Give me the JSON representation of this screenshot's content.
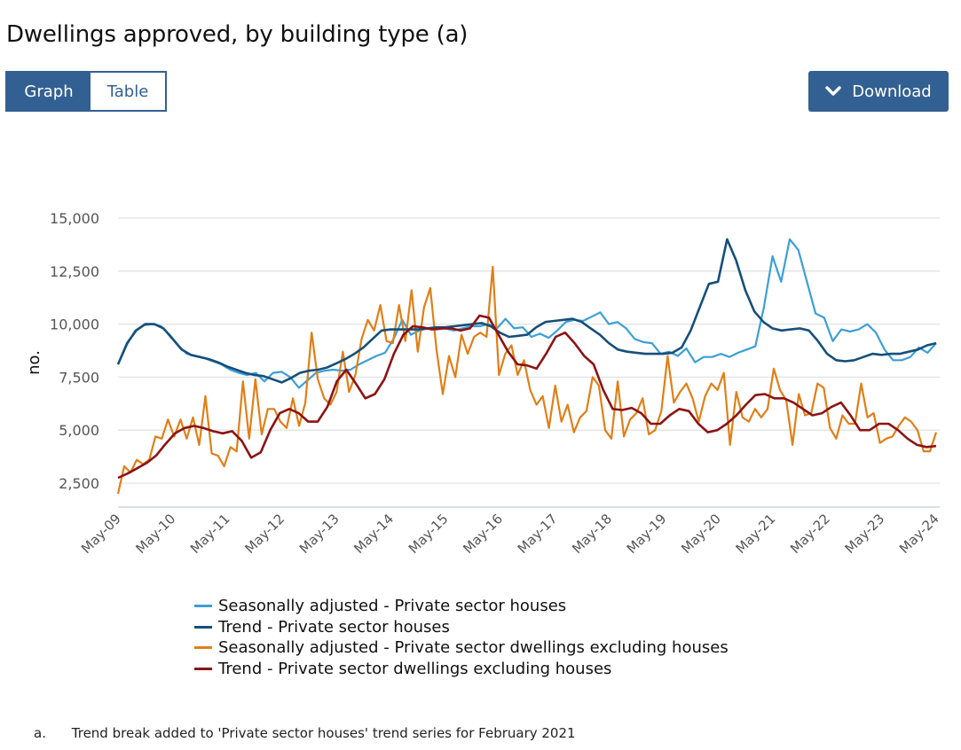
{
  "title": "Dwellings approved, by building type (a)",
  "view_toggle": {
    "graph_label": "Graph",
    "table_label": "Table",
    "active": "Graph"
  },
  "download": {
    "label": "Download",
    "icon": "chevron-down-icon"
  },
  "colors": {
    "sa_houses": "#3b9fd6",
    "trend_houses": "#164f7a",
    "sa_other": "#e07f17",
    "trend_other": "#8b1414",
    "accent": "#336092"
  },
  "footnote": {
    "marker": "a.",
    "text": "Trend break added to 'Private sector houses' trend series for February 2021"
  },
  "chart_data": {
    "type": "line",
    "title": "Dwellings approved, by building type (a)",
    "xlabel": "",
    "ylabel": "no.",
    "ylim": [
      1400,
      15000
    ],
    "yticks": [
      2500,
      5000,
      7500,
      10000,
      12500,
      15000
    ],
    "ytick_labels": [
      "2,500",
      "5,000",
      "7,500",
      "10,000",
      "12,500",
      "15,000"
    ],
    "xtick_labels": [
      "May-09",
      "May-10",
      "May-11",
      "May-12",
      "May-13",
      "May-14",
      "May-15",
      "May-16",
      "May-17",
      "May-18",
      "May-19",
      "May-20",
      "May-21",
      "May-22",
      "May-23",
      "May-24"
    ],
    "x_start": "May-09",
    "x_step_months": 2,
    "grid": true,
    "legend_position": "bottom",
    "series": [
      {
        "name": "Seasonally adjusted - Private sector houses",
        "color_key": "sa_houses",
        "values": [
          8100,
          9000,
          9700,
          9950,
          10000,
          9900,
          9500,
          9000,
          8600,
          8500,
          8400,
          8250,
          8100,
          7850,
          7700,
          7600,
          7700,
          7300,
          7700,
          7750,
          7500,
          7000,
          7350,
          7700,
          7800,
          7850,
          7800,
          7850,
          8100,
          8300,
          8500,
          8650,
          9300,
          10200,
          9500,
          9700,
          9800,
          9750,
          9800,
          9700,
          9800,
          9900,
          9900,
          10000,
          9800,
          10250,
          9800,
          9850,
          9400,
          9550,
          9350,
          9700,
          10100,
          10200,
          10150,
          10350,
          10550,
          10000,
          10100,
          9800,
          9300,
          9150,
          9100,
          8600,
          8700,
          8500,
          8850,
          8200,
          8450,
          8450,
          8600,
          8450,
          8650,
          8800,
          8950,
          10800,
          13200,
          12000,
          14000,
          13500,
          12000,
          10500,
          10300,
          9200,
          9750,
          9650,
          9750,
          10000,
          9600,
          8800,
          8300,
          8300,
          8450,
          8900,
          8650,
          9100
        ]
      },
      {
        "name": "Trend - Private sector houses",
        "color_key": "trend_houses",
        "values": [
          8100,
          9100,
          9700,
          10000,
          10000,
          9800,
          9300,
          8800,
          8550,
          8450,
          8350,
          8200,
          8000,
          7850,
          7700,
          7600,
          7550,
          7400,
          7250,
          7450,
          7700,
          7800,
          7850,
          7950,
          8150,
          8350,
          8600,
          8900,
          9300,
          9700,
          9750,
          9750,
          9750,
          9750,
          9800,
          9850,
          9850,
          9900,
          9950,
          10000,
          10050,
          9900,
          9600,
          9400,
          9450,
          9500,
          9850,
          10100,
          10150,
          10200,
          10250,
          10100,
          9800,
          9500,
          9100,
          8800,
          8700,
          8650,
          8600,
          8600,
          8600,
          8650,
          8900,
          9700,
          10800,
          11900,
          12000,
          14000,
          13000,
          11600,
          10600,
          10100,
          9800,
          9700,
          9750,
          9800,
          9700,
          9200,
          8600,
          8300,
          8250,
          8300,
          8450,
          8600,
          8550,
          8600,
          8600,
          8700,
          8800,
          9000,
          9100
        ]
      },
      {
        "name": "Seasonally adjusted - Private sector dwellings excluding houses",
        "color_key": "sa_other",
        "values": [
          2000,
          3300,
          3000,
          3600,
          3400,
          3600,
          4700,
          4600,
          5500,
          4700,
          5500,
          4600,
          5600,
          4300,
          6600,
          3900,
          3800,
          3300,
          4200,
          4000,
          7300,
          4600,
          7400,
          4800,
          6000,
          6000,
          5400,
          5100,
          6500,
          5200,
          6300,
          9600,
          7400,
          6500,
          6200,
          6800,
          8700,
          6800,
          7600,
          9300,
          10200,
          9700,
          10900,
          9200,
          9100,
          10900,
          9200,
          11600,
          8700,
          10800,
          11700,
          8800,
          6700,
          8500,
          7500,
          9500,
          8600,
          9400,
          9600,
          9400,
          12700,
          7600,
          8600,
          9000,
          7600,
          8300,
          6900,
          6200,
          6600,
          5100,
          7100,
          5400,
          6200,
          4900,
          5600,
          5900,
          7500,
          7100,
          5000,
          4600,
          7300,
          4700,
          5500,
          5800,
          6500,
          4800,
          5000,
          5900,
          8500,
          6300,
          6800,
          7200,
          6500,
          5400,
          6600,
          7200,
          6900,
          7700,
          4300,
          6800,
          5600,
          5400,
          6000,
          5600,
          6000,
          7900,
          6900,
          6400,
          4300,
          6700,
          5700,
          5800,
          7200,
          7000,
          5100,
          4600,
          5700,
          5300,
          5300,
          7200,
          5600,
          5800,
          4400,
          4600,
          4700,
          5200,
          5600,
          5400,
          5000,
          4000,
          4000,
          4900
        ]
      },
      {
        "name": "Trend - Private sector dwellings excluding houses",
        "color_key": "trend_other",
        "values": [
          2750,
          2950,
          3200,
          3450,
          3800,
          4350,
          4850,
          5100,
          5200,
          5100,
          4950,
          4850,
          4950,
          4500,
          3700,
          3950,
          5000,
          5800,
          6000,
          5800,
          5400,
          5400,
          6100,
          7300,
          7850,
          7200,
          6500,
          6700,
          7400,
          8600,
          9500,
          9900,
          9850,
          9750,
          9800,
          9800,
          9700,
          9800,
          10400,
          10300,
          9500,
          8700,
          8100,
          8050,
          7900,
          8600,
          9400,
          9600,
          9100,
          8500,
          8100,
          6900,
          6000,
          5950,
          6050,
          5800,
          5300,
          5300,
          5700,
          6000,
          5900,
          5300,
          4900,
          5000,
          5300,
          5700,
          6200,
          6650,
          6700,
          6500,
          6500,
          6300,
          6000,
          5700,
          5800,
          6100,
          6300,
          5700,
          5000,
          5000,
          5300,
          5300,
          5000,
          4600,
          4300,
          4200,
          4250
        ]
      }
    ]
  }
}
